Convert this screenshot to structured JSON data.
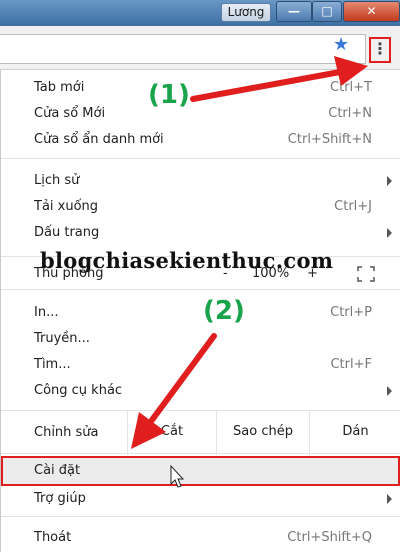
{
  "window": {
    "user_chip": "Lương",
    "minimize_glyph": "—",
    "maximize_glyph": "□",
    "close_glyph": "✕"
  },
  "toolbar": {
    "bookmark_icon": "star-icon",
    "menu_icon": "more-vertical-icon",
    "menu_glyph": "⋮"
  },
  "menu": {
    "new_tab": {
      "label": "Tab mới",
      "shortcut": "Ctrl+T"
    },
    "new_window": {
      "label": "Cửa sổ Mới",
      "shortcut": "Ctrl+N"
    },
    "incognito": {
      "label": "Cửa sổ ẩn danh mới",
      "shortcut": "Ctrl+Shift+N"
    },
    "history": {
      "label": "Lịch sử"
    },
    "downloads": {
      "label": "Tải xuống",
      "shortcut": "Ctrl+J"
    },
    "bookmarks": {
      "label": "Dấu trang"
    },
    "zoom": {
      "label": "Thu phóng",
      "minus": "-",
      "value": "100%",
      "plus": "+"
    },
    "print": {
      "label": "In...",
      "shortcut": "Ctrl+P"
    },
    "cast": {
      "label": "Truyền..."
    },
    "find": {
      "label": "Tìm...",
      "shortcut": "Ctrl+F"
    },
    "more_tools": {
      "label": "Công cụ khác"
    },
    "edit": {
      "label": "Chỉnh sửa",
      "cut": "Cắt",
      "copy": "Sao chép",
      "paste": "Dán"
    },
    "settings": {
      "label": "Cài đặt"
    },
    "help": {
      "label": "Trợ giúp"
    },
    "exit": {
      "label": "Thoát",
      "shortcut": "Ctrl+Shift+Q"
    }
  },
  "annotations": {
    "step1": "(1)",
    "step2": "(2)",
    "watermark": "blogchiasekienthuc.com",
    "arrow_color": "#e01e1e",
    "step_color": "#19a34a"
  }
}
